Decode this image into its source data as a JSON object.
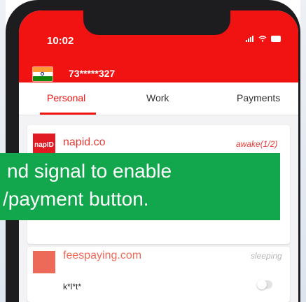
{
  "status_bar": {
    "time": "10:02",
    "signal_icon": "signal-icon",
    "wifi_icon": "wifi-icon",
    "battery_icon": "battery-icon"
  },
  "account": {
    "flag_icon": "india-flag-icon",
    "phone_number": "73*****327"
  },
  "tabs": [
    {
      "label": "Personal",
      "active": true
    },
    {
      "label": "Work",
      "active": false
    },
    {
      "label": "Payments",
      "active": false
    }
  ],
  "cards": [
    {
      "logo_text": "napID",
      "title": "napid.co",
      "status": "awake(1/2)"
    },
    {
      "title": "feespaying.com",
      "status": "sleeping",
      "username": "k*l*t*",
      "toggle_on": false
    }
  ],
  "banner": {
    "line1": "nd signal to enable",
    "line2": "/payment button."
  },
  "colors": {
    "header_red": "#f11212",
    "banner_green": "#12a64d",
    "napid_red": "#e01b24",
    "fees_orange": "#ee6a58"
  }
}
